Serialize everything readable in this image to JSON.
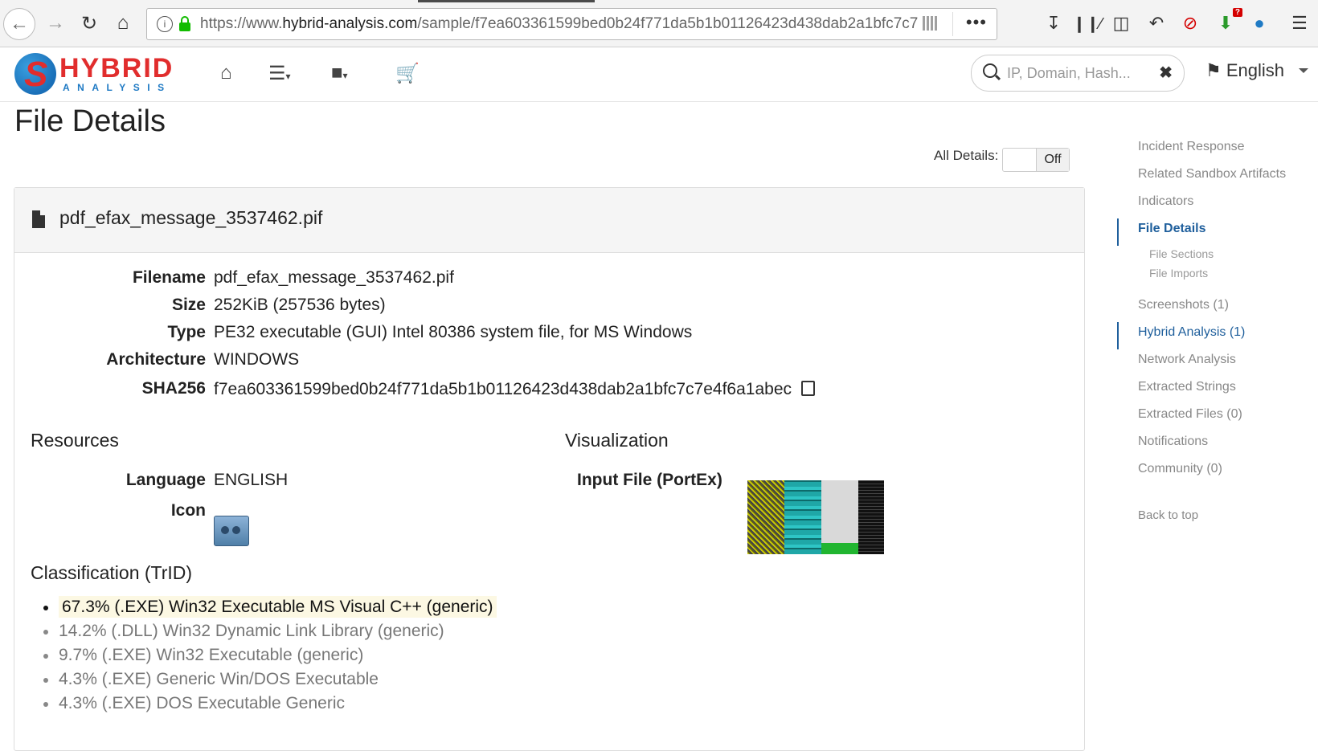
{
  "browser": {
    "url_prefix": "https://www.",
    "url_domain": "hybrid-analysis.com",
    "url_path": "/sample/f7ea603361599bed0b24f771da5b1b01126423d438dab2a1bfc7c7",
    "more_label": "•••"
  },
  "header": {
    "logo_main": "HYBRID",
    "logo_sub": "ANALYSIS",
    "search_placeholder": "IP, Domain, Hash...",
    "language": "English"
  },
  "page": {
    "title": "File Details",
    "all_details_label": "All Details:",
    "toggle_state": "Off"
  },
  "file": {
    "name": "pdf_efax_message_3537462.pif",
    "rows": [
      {
        "label": "Filename",
        "value": "pdf_efax_message_3537462.pif"
      },
      {
        "label": "Size",
        "value": "252KiB (257536 bytes)"
      },
      {
        "label": "Type",
        "value": "PE32 executable (GUI) Intel 80386 system file, for MS Windows"
      },
      {
        "label": "Architecture",
        "value": "WINDOWS"
      },
      {
        "label": "SHA256",
        "value": "f7ea603361599bed0b24f771da5b1b01126423d438dab2a1bfc7c7e4f6a1abec"
      }
    ]
  },
  "resources": {
    "heading": "Resources",
    "language_label": "Language",
    "language_value": "ENGLISH",
    "icon_label": "Icon"
  },
  "visualization": {
    "heading": "Visualization",
    "label": "Input File (PortEx)"
  },
  "classification": {
    "heading": "Classification (TrID)",
    "items": [
      "67.3% (.EXE) Win32 Executable MS Visual C++ (generic)",
      "14.2% (.DLL) Win32 Dynamic Link Library (generic)",
      "9.7% (.EXE) Win32 Executable (generic)",
      "4.3% (.EXE) Generic Win/DOS Executable",
      "4.3% (.EXE) DOS Executable Generic"
    ]
  },
  "sidenav": {
    "items": [
      "Incident Response",
      "Related Sandbox Artifacts",
      "Indicators",
      "File Details",
      "File Sections",
      "File Imports",
      "Screenshots (1)",
      "Hybrid Analysis (1)",
      "Network Analysis",
      "Extracted Strings",
      "Extracted Files (0)",
      "Notifications",
      "Community (0)",
      "Back to top"
    ]
  },
  "colors": {
    "accent": "#1f5f9c",
    "brand_red": "#e12d2d",
    "highlight": "#fcf8e3"
  }
}
